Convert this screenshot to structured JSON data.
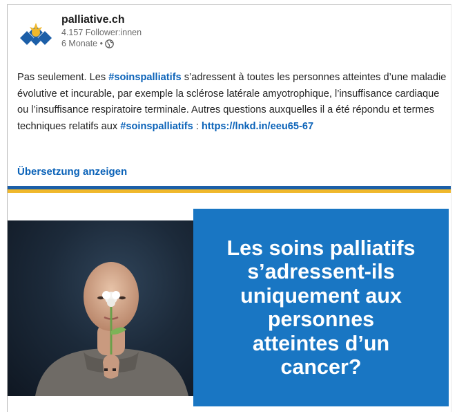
{
  "post": {
    "author": {
      "name": "palliative.ch",
      "followers": "4.157 Follower:innen",
      "time": "6 Monate •",
      "logo_icon": "palliative-logo-icon",
      "visibility_icon": "globe-icon"
    },
    "text": {
      "part1": "Pas seulement. Les ",
      "hashtag1": "#soinspalliatifs",
      "part2": " s’adressent à toutes les personnes atteintes d’une maladie évolutive et incurable, par exemple la sclérose latérale amyotrophique, l’insuffisance cardiaque ou l’insuffisance respiratoire terminale. Autres questions auxquelles il a été répondu et termes techniques relatifs aux ",
      "hashtag2": "#soinspalliatifs",
      "part3": " : ",
      "link": "https://lnkd.in/eeu65-67"
    },
    "translate_label": "Übersetzung anzeigen"
  },
  "image": {
    "headline": "Les soins palliatifs\ns’adressent-ils\nuniquement aux\npersonnes\natteintes d’un\ncancer?",
    "colors": {
      "headline_bg": "#1976c3",
      "stripe_blue": "#1c5fa8",
      "stripe_yellow": "#f0b82c",
      "link": "#0a62b8"
    }
  }
}
